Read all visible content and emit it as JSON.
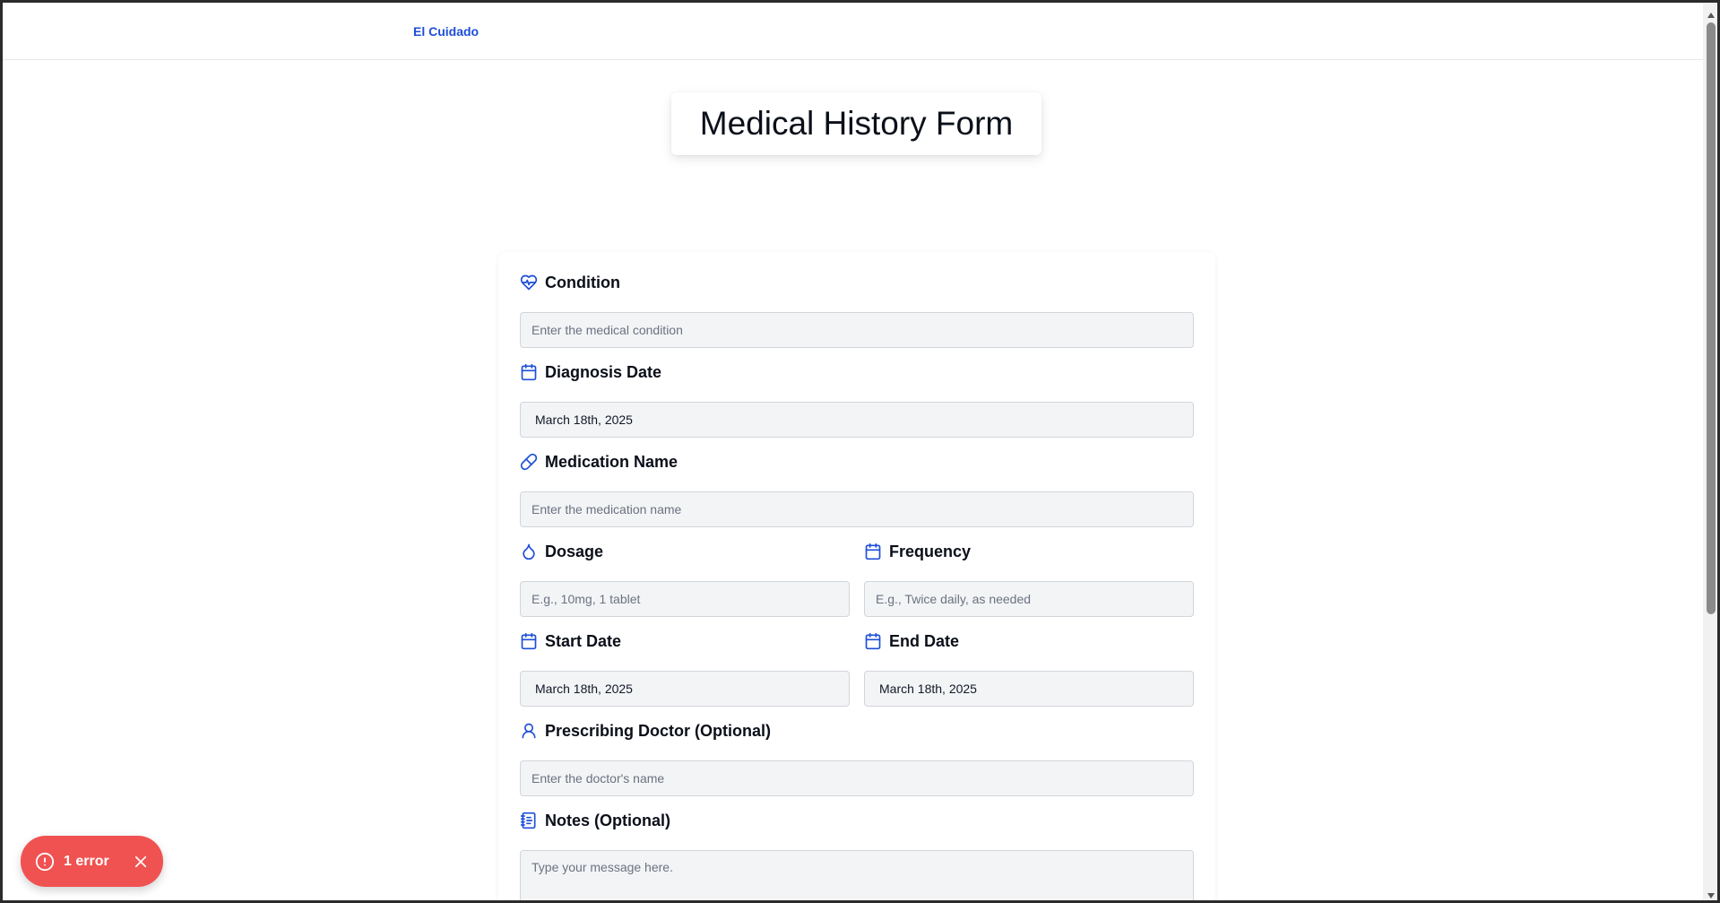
{
  "header": {
    "brand": "El Cuidado"
  },
  "page": {
    "title": "Medical History Form"
  },
  "form": {
    "condition": {
      "label": "Condition",
      "placeholder": "Enter the medical condition",
      "icon": "heart-pulse-icon"
    },
    "diagnosis_date": {
      "label": "Diagnosis Date",
      "value": "March 18th, 2025",
      "icon": "calendar-icon"
    },
    "medication_name": {
      "label": "Medication Name",
      "placeholder": "Enter the medication name",
      "icon": "pill-icon"
    },
    "dosage": {
      "label": "Dosage",
      "placeholder": "E.g., 10mg, 1 tablet",
      "icon": "droplet-icon"
    },
    "frequency": {
      "label": "Frequency",
      "placeholder": "E.g., Twice daily, as needed",
      "icon": "calendar-icon"
    },
    "start_date": {
      "label": "Start Date",
      "value": "March 18th, 2025",
      "icon": "calendar-icon"
    },
    "end_date": {
      "label": "End Date",
      "value": "March 18th, 2025",
      "icon": "calendar-icon"
    },
    "prescribing_doctor": {
      "label": "Prescribing Doctor (Optional)",
      "placeholder": "Enter the doctor's name",
      "icon": "user-icon"
    },
    "notes": {
      "label": "Notes (Optional)",
      "placeholder": "Type your message here.",
      "icon": "notebook-icon"
    }
  },
  "toast": {
    "text": "1 error",
    "color": "#f05252"
  },
  "colors": {
    "accent": "#1d4ed8",
    "input_bg": "#f3f4f6"
  }
}
